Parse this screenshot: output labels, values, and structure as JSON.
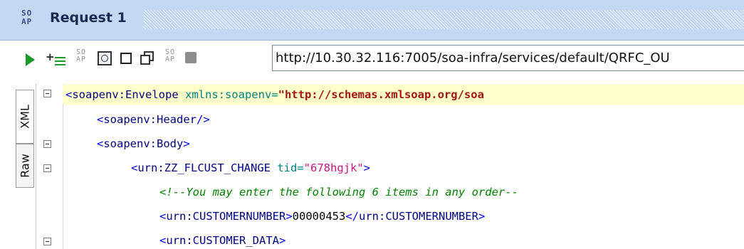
{
  "title": {
    "icon_text_top": "SO",
    "icon_text_bottom": "AP",
    "label": "Request 1"
  },
  "toolbar": {
    "url": "http://10.30.32.116:7005/soa-infra/services/default/QRFC_OU",
    "soap_top": "SO",
    "soap_bottom": "AP"
  },
  "side_tabs": {
    "xml": "XML",
    "raw": "Raw"
  },
  "code": {
    "l1": {
      "open": "<",
      "tag": "soapenv:Envelope",
      "attr": " xmlns:soapenv=",
      "val": "\"http://schemas.xmlsoap.org/soa"
    },
    "l2": {
      "open": "<",
      "tag": "soapenv:Header",
      "close": "/>"
    },
    "l3": {
      "open": "<",
      "tag": "soapenv:Body",
      "close": ">"
    },
    "l4": {
      "open": "<",
      "tag": "urn:ZZ_FLCUST_CHANGE",
      "attr": " tid=",
      "val": "\"678hgjk\"",
      "close": ">"
    },
    "l5": {
      "comment": "<!--You may enter the following 6 items in any order--"
    },
    "l6": {
      "open": "<",
      "tag": "urn:CUSTOMERNUMBER",
      "close1": ">",
      "text": "00000453",
      "open2": "</",
      "tag2": "urn:CUSTOMERNUMBER",
      "close2": ">"
    },
    "l7": {
      "open": "<",
      "tag": "urn:CUSTOMER_DATA",
      "close": ">"
    }
  },
  "colors": {
    "titlebar": "#c4d8f2",
    "run": "#1c9a2a",
    "highlight": "#ffffcc"
  }
}
